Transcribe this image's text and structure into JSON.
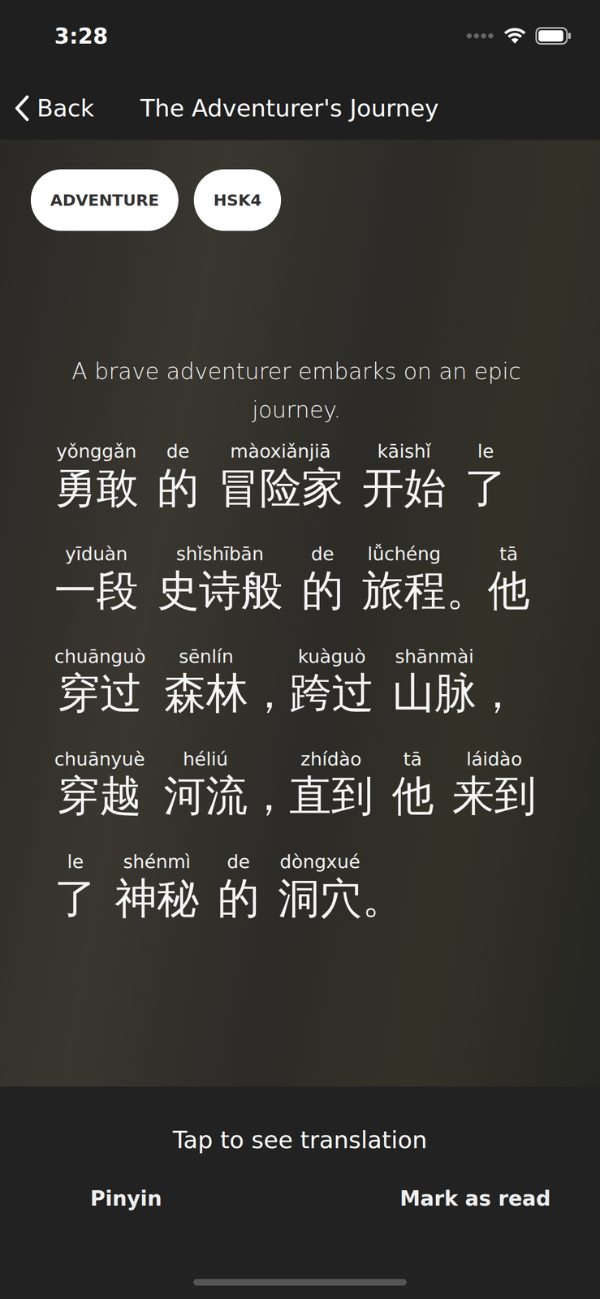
{
  "status_bar": {
    "time": "3:28",
    "signal_level": 0,
    "battery_level": 0.95
  },
  "nav": {
    "back": "Back",
    "title": "The Adventurer's Journey"
  },
  "tags": [
    "ADVENTURE",
    "HSK4"
  ],
  "summary": "A brave adventurer embarks on an epic journey.",
  "pinyin_visible": true,
  "words": [
    {
      "hanzi": "勇敢",
      "pinyin": "yǒnggǎn",
      "punct": ""
    },
    {
      "hanzi": "的",
      "pinyin": "de",
      "punct": ""
    },
    {
      "hanzi": "冒险家",
      "pinyin": "màoxiǎnjiā",
      "punct": ""
    },
    {
      "hanzi": "开始",
      "pinyin": "kāishǐ",
      "punct": ""
    },
    {
      "hanzi": "了",
      "pinyin": "le",
      "punct": ""
    },
    {
      "hanzi": "一段",
      "pinyin": "yīduàn",
      "punct": ""
    },
    {
      "hanzi": "史诗般",
      "pinyin": "shǐshībān",
      "punct": ""
    },
    {
      "hanzi": "的",
      "pinyin": "de",
      "punct": ""
    },
    {
      "hanzi": "旅程",
      "pinyin": "lǚchéng",
      "punct": "。"
    },
    {
      "hanzi": "他",
      "pinyin": "tā",
      "punct": ""
    },
    {
      "hanzi": "穿过",
      "pinyin": "chuānguò",
      "punct": ""
    },
    {
      "hanzi": "森林",
      "pinyin": "sēnlín",
      "punct": "，"
    },
    {
      "hanzi": "跨过",
      "pinyin": "kuàguò",
      "punct": ""
    },
    {
      "hanzi": "山脉",
      "pinyin": "shānmài",
      "punct": "，"
    },
    {
      "hanzi": "穿越",
      "pinyin": "chuānyuè",
      "punct": ""
    },
    {
      "hanzi": "河流",
      "pinyin": "héliú",
      "punct": "，"
    },
    {
      "hanzi": "直到",
      "pinyin": "zhídào",
      "punct": ""
    },
    {
      "hanzi": "他",
      "pinyin": "tā",
      "punct": ""
    },
    {
      "hanzi": "来到",
      "pinyin": "láidào",
      "punct": ""
    },
    {
      "hanzi": "了",
      "pinyin": "le",
      "punct": ""
    },
    {
      "hanzi": "神秘",
      "pinyin": "shénmì",
      "punct": ""
    },
    {
      "hanzi": "的",
      "pinyin": "de",
      "punct": ""
    },
    {
      "hanzi": "洞穴",
      "pinyin": "dòngxué",
      "punct": "。"
    }
  ],
  "translation_hint": "Tap to see translation",
  "actions": [
    {
      "label": "Pinyin"
    },
    {
      "label": "Mark as read"
    }
  ]
}
